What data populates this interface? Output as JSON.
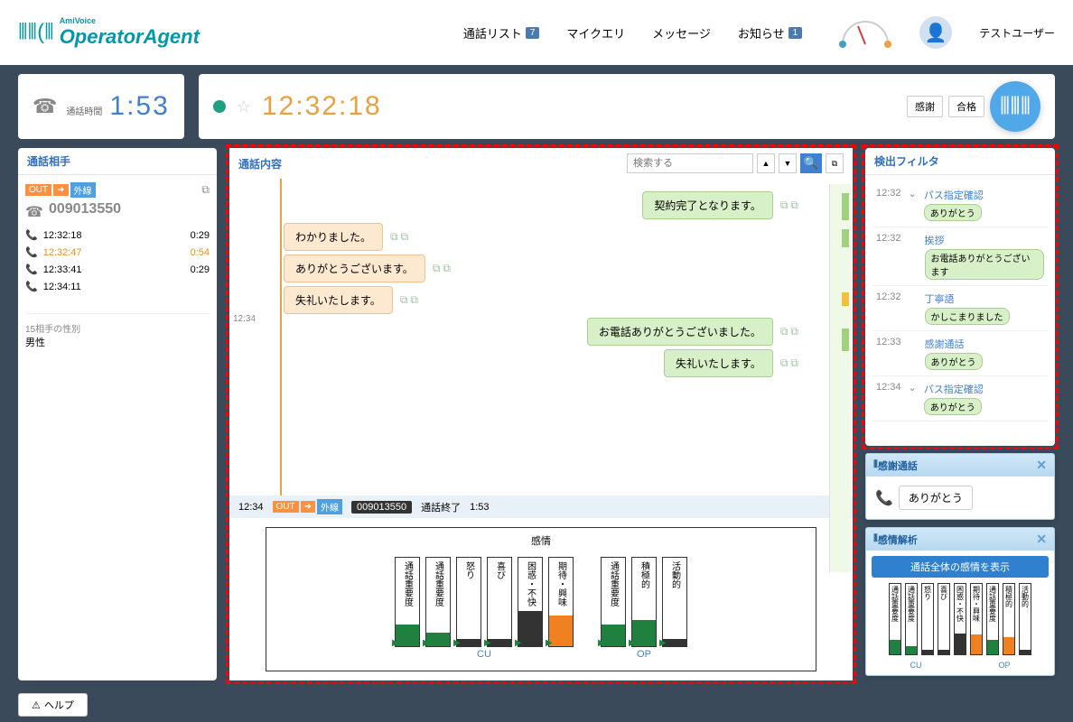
{
  "window": {
    "minimize": "—",
    "maximize": "□",
    "close": "✕"
  },
  "brand": {
    "super": "AmiVoice",
    "main": "OperatorAgent"
  },
  "topnav": {
    "call_list": "通話リスト",
    "call_list_badge": "7",
    "my_query": "マイクエリ",
    "message": "メッセージ",
    "notice": "お知らせ",
    "notice_badge": "1",
    "user_name": "テストユーザー"
  },
  "status": {
    "call_time_label": "通話時間",
    "call_time": "1:53",
    "clock": "12:32:18",
    "btn_thanks": "感謝",
    "btn_pass": "合格"
  },
  "left_panel": {
    "title": "通話相手",
    "out": "OUT",
    "ext": "外線",
    "number": "009013550",
    "rows": [
      {
        "time": "12:32:18",
        "dur": "0:29",
        "cls": ""
      },
      {
        "time": "12:32:47",
        "dur": "0:54",
        "cls": "orange"
      },
      {
        "time": "12:33:41",
        "dur": "0:29",
        "cls": ""
      },
      {
        "time": "12:34:11",
        "dur": "",
        "cls": "gray"
      }
    ],
    "gender_label": "15相手の性別",
    "gender_value": "男性"
  },
  "conv": {
    "title": "通話内容",
    "search_placeholder": "検索する",
    "ts1": "12:34",
    "messages": [
      {
        "side": "op",
        "text": "契約完了となります。"
      },
      {
        "side": "cu",
        "text": "わかりました。"
      },
      {
        "side": "cu",
        "text": "ありがとうございます。"
      },
      {
        "side": "cu",
        "text": "失礼いたします。"
      },
      {
        "side": "op",
        "text": "お電話ありがとうございました。"
      },
      {
        "side": "op",
        "text": "失礼いたします。"
      }
    ],
    "footer": {
      "time": "12:34",
      "out": "OUT",
      "ext": "外線",
      "num": "009013550",
      "end": "通話終了",
      "dur": "1:53"
    }
  },
  "emotion": {
    "title": "感情",
    "cu_label": "CU",
    "op_label": "OP",
    "cu": [
      "通話重要度",
      "通話重要度",
      "怒り",
      "喜び",
      "困惑・不快",
      "期待・興味"
    ],
    "op": [
      "通話重要度",
      "積極的",
      "活動的"
    ]
  },
  "filter": {
    "title": "検出フィルタ",
    "items": [
      {
        "time": "12:32",
        "name": "パス指定確認",
        "tag": "ありがとう",
        "chev": true
      },
      {
        "time": "12:32",
        "name": "挨拶",
        "tag": "お電話ありがとうございます",
        "chev": false
      },
      {
        "time": "12:32",
        "name": "丁寧語",
        "tag": "かしこまりました",
        "chev": false
      },
      {
        "time": "12:33",
        "name": "感謝通話",
        "tag": "ありがとう",
        "chev": false
      },
      {
        "time": "12:34",
        "name": "パス指定確認",
        "tag": "ありがとう",
        "chev": true
      }
    ]
  },
  "thanks_popup": {
    "title": "感謝通話",
    "text": "ありがとう"
  },
  "emo_popup": {
    "title": "感情解析",
    "button": "通話全体の感情を表示",
    "bars": [
      "通話重要度",
      "通話重要度",
      "怒り",
      "喜び",
      "困惑・不快",
      "期待・興味",
      "通話重要度",
      "積極的",
      "活動的"
    ],
    "cu": "CU",
    "op": "OP"
  },
  "help": "ヘルプ"
}
